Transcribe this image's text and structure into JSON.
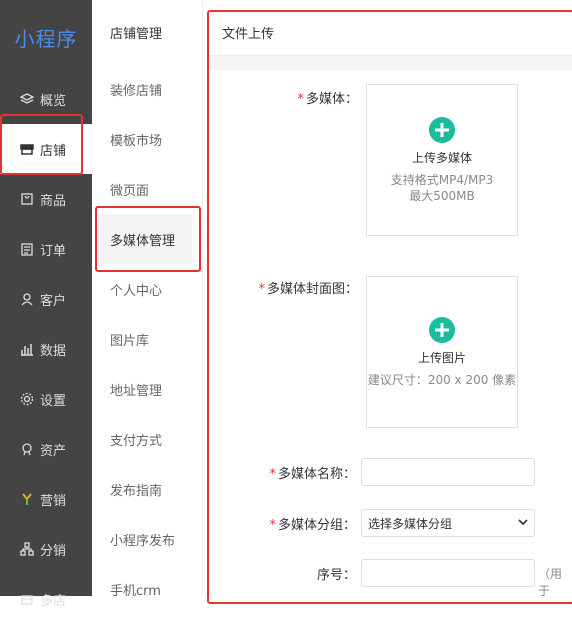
{
  "logo": "小程序",
  "left_nav": [
    {
      "label": "概览",
      "icon": "layers-icon"
    },
    {
      "label": "店铺",
      "icon": "store-icon",
      "active": true
    },
    {
      "label": "商品",
      "icon": "bag-icon"
    },
    {
      "label": "订单",
      "icon": "clipboard-icon"
    },
    {
      "label": "客户",
      "icon": "user-icon"
    },
    {
      "label": "数据",
      "icon": "bar-chart-icon"
    },
    {
      "label": "设置",
      "icon": "gear-icon"
    },
    {
      "label": "资产",
      "icon": "medal-icon"
    },
    {
      "label": "营销",
      "icon": "branch-icon"
    },
    {
      "label": "分销",
      "icon": "network-icon"
    },
    {
      "label": "多店",
      "icon": "stores-icon"
    }
  ],
  "sub_nav": {
    "title": "店铺管理",
    "items": [
      "装修店铺",
      "模板市场",
      "微页面",
      "多媒体管理",
      "个人中心",
      "图片库",
      "地址管理",
      "支付方式",
      "发布指南",
      "小程序发布",
      "手机crm"
    ]
  },
  "main": {
    "header": "文件上传",
    "media_label": "多媒体：",
    "media_upload_label": "上传多媒体",
    "media_hint_1": "支持格式MP4/MP3",
    "media_hint_2": "最大500MB",
    "cover_label": "多媒体封面图：",
    "cover_upload_label": "上传图片",
    "cover_hint": "建议尺寸：200 x 200 像素",
    "name_label": "多媒体名称：",
    "name_value": "",
    "group_label": "多媒体分组：",
    "group_selected": "选择多媒体分组",
    "seq_label": "序号：",
    "seq_value": "",
    "seq_note": "（用于"
  },
  "accent_colors": {
    "highlight": "#e53333",
    "plus": "#1abc9c",
    "sidebar": "#444444"
  }
}
